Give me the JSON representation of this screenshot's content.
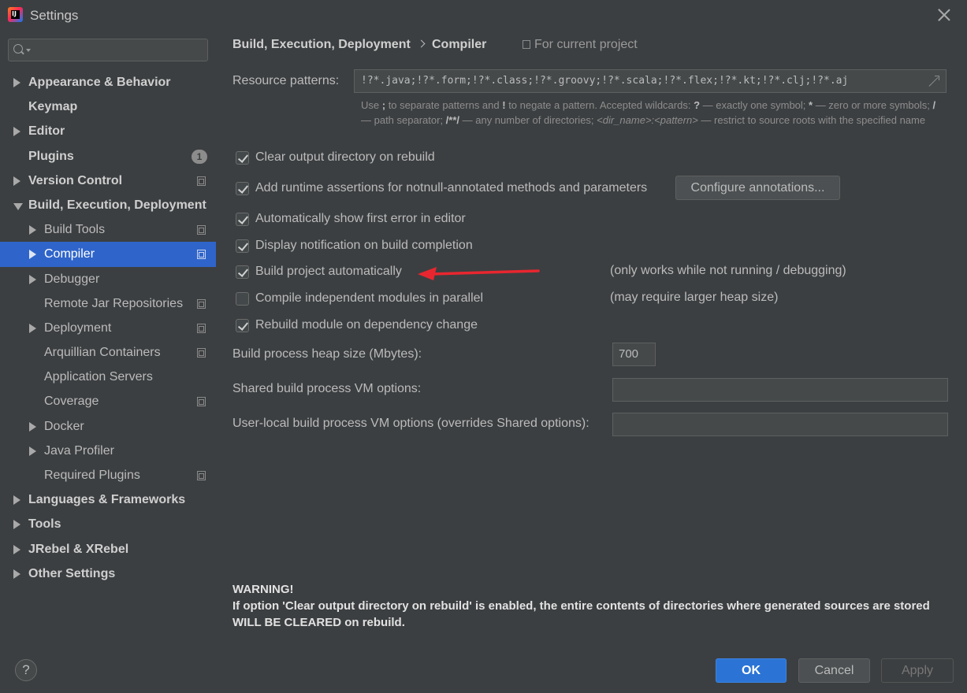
{
  "window": {
    "title": "Settings"
  },
  "sidebar": {
    "search_placeholder": "",
    "items": [
      {
        "label": "Appearance & Behavior",
        "level": 0,
        "arrow": "right"
      },
      {
        "label": "Keymap",
        "level": 0
      },
      {
        "label": "Editor",
        "level": 0,
        "arrow": "right"
      },
      {
        "label": "Plugins",
        "level": 0,
        "badge": "1"
      },
      {
        "label": "Version Control",
        "level": 0,
        "arrow": "right",
        "project_icon": true
      },
      {
        "label": "Build, Execution, Deployment",
        "level": 0,
        "arrow": "down"
      },
      {
        "label": "Build Tools",
        "level": 1,
        "arrow": "right",
        "project_icon": true
      },
      {
        "label": "Compiler",
        "level": 1,
        "arrow": "right",
        "project_icon": true,
        "selected": true
      },
      {
        "label": "Debugger",
        "level": 1,
        "arrow": "right"
      },
      {
        "label": "Remote Jar Repositories",
        "level": 1,
        "project_icon": true
      },
      {
        "label": "Deployment",
        "level": 1,
        "arrow": "right",
        "project_icon": true
      },
      {
        "label": "Arquillian Containers",
        "level": 1,
        "project_icon": true
      },
      {
        "label": "Application Servers",
        "level": 1
      },
      {
        "label": "Coverage",
        "level": 1,
        "project_icon": true
      },
      {
        "label": "Docker",
        "level": 1,
        "arrow": "right"
      },
      {
        "label": "Java Profiler",
        "level": 1,
        "arrow": "right"
      },
      {
        "label": "Required Plugins",
        "level": 1,
        "project_icon": true
      },
      {
        "label": "Languages & Frameworks",
        "level": 0,
        "arrow": "right"
      },
      {
        "label": "Tools",
        "level": 0,
        "arrow": "right"
      },
      {
        "label": "JRebel & XRebel",
        "level": 0,
        "arrow": "right"
      },
      {
        "label": "Other Settings",
        "level": 0,
        "arrow": "right"
      }
    ]
  },
  "header": {
    "breadcrumb_first": "Build, Execution, Deployment",
    "breadcrumb_second": "Compiler",
    "scope": "For current project"
  },
  "compiler": {
    "resource_label": "Resource patterns:",
    "resource_value": "!?*.java;!?*.form;!?*.class;!?*.groovy;!?*.scala;!?*.flex;!?*.kt;!?*.clj;!?*.aj",
    "hint": {
      "p1": "Use ",
      "semicolon": ";",
      "p2": " to separate patterns and ",
      "bang": "!",
      "p3": " to negate a pattern. Accepted wildcards: ",
      "qmark": "?",
      "p4": " — exactly one symbol; ",
      "star": "*",
      "p5": " — zero or more symbols; ",
      "slash": "/",
      "p6": " — path separator; ",
      "dstar": "/**/",
      "p7": " — any number of directories; ",
      "dirname": "<dir_name>:<pattern>",
      "p8": " — restrict to source roots with the specified name"
    },
    "options": [
      {
        "label": "Clear output directory on rebuild",
        "checked": true
      },
      {
        "label": "Add runtime assertions for notnull-annotated methods and parameters",
        "checked": true
      },
      {
        "label": "Automatically show first error in editor",
        "checked": true
      },
      {
        "label": "Display notification on build completion",
        "checked": true
      },
      {
        "label": "Build project automatically",
        "checked": true,
        "note": "(only works while not running / debugging)"
      },
      {
        "label": "Compile independent modules in parallel",
        "checked": false,
        "note": "(may require larger heap size)"
      },
      {
        "label": "Rebuild module on dependency change",
        "checked": true
      }
    ],
    "configure_button": "Configure annotations...",
    "heap_label": "Build process heap size (Mbytes):",
    "heap_value": "700",
    "shared_vm_label": "Shared build process VM options:",
    "shared_vm_value": "",
    "user_vm_label": "User-local build process VM options (overrides Shared options):",
    "user_vm_value": "",
    "warning_title": "WARNING!",
    "warning_text": "If option 'Clear output directory on rebuild' is enabled, the entire contents of directories where generated sources are stored WILL BE CLEARED on rebuild."
  },
  "footer": {
    "help": "?",
    "ok": "OK",
    "cancel": "Cancel",
    "apply": "Apply"
  },
  "colors": {
    "background": "#3c3f41",
    "selection": "#2f65ca",
    "ok_button": "#2b74d5",
    "annotation_arrow": "#e8262f"
  }
}
